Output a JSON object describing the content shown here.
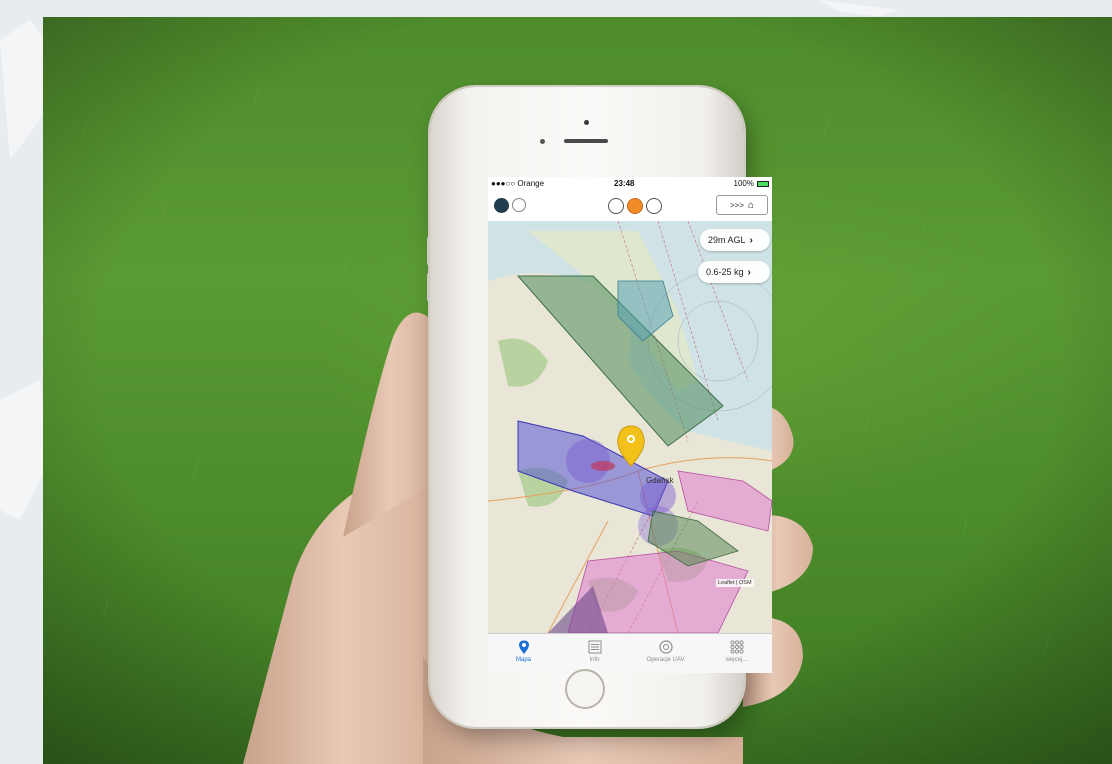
{
  "phone_screen": {
    "status_bar": {
      "carrier": "●●●○○ Orange",
      "time": "23:48",
      "battery": "100%"
    },
    "toolbar": {
      "home_nav_label": ">>>",
      "mode_dots": [
        "inactive",
        "active",
        "inactive"
      ]
    },
    "map": {
      "altitude_filter": "29m AGL",
      "weight_filter": "0.6-25 kg",
      "attribution": "Leaflet | OSM",
      "city_label": "Gdańsk",
      "marker_color": "#f2c21a"
    },
    "tabs": [
      {
        "label": "Mapa",
        "icon": "map-pin-icon",
        "active": true
      },
      {
        "label": "Info",
        "icon": "list-icon",
        "active": false
      },
      {
        "label": "Operacje UAV",
        "icon": "drone-icon",
        "active": false
      },
      {
        "label": "więcej...",
        "icon": "grid-icon",
        "active": false
      }
    ]
  },
  "colors": {
    "accent_orange": "#f28c28",
    "tab_active": "#1a6ed8",
    "zone_green": "#4e8a5a",
    "zone_blue": "#5a55d6",
    "zone_pink": "#e07ad0"
  }
}
